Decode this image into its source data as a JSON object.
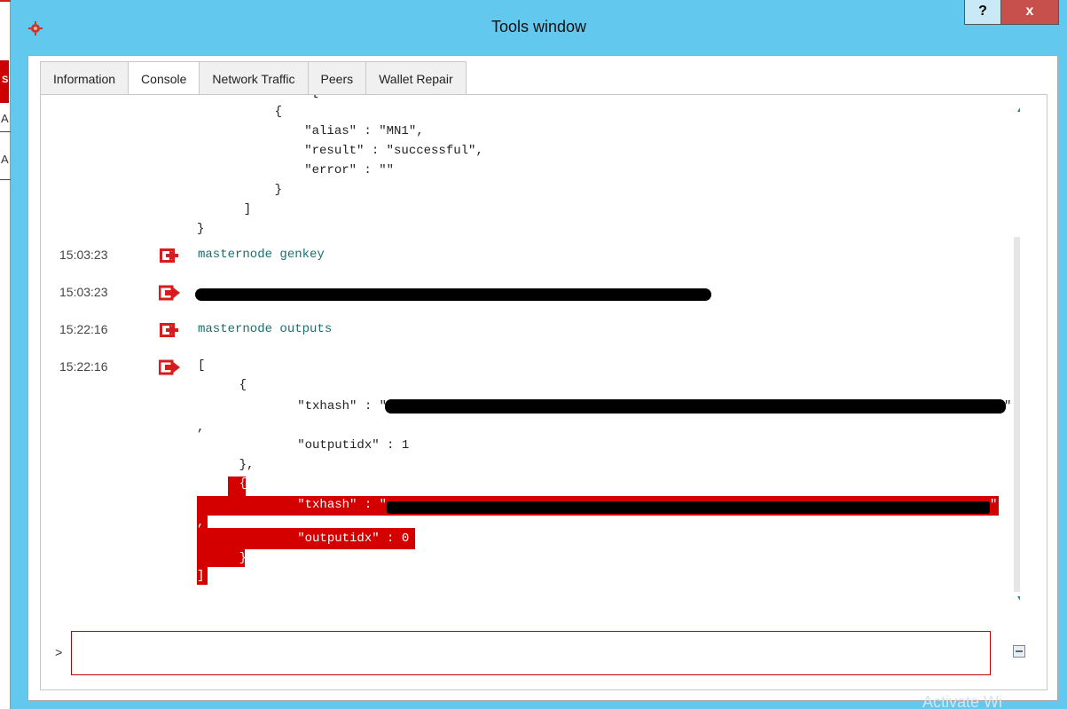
{
  "background_app": {
    "letters": [
      "S",
      "A",
      "A"
    ]
  },
  "window": {
    "title": "Tools window",
    "help_label": "?",
    "close_label": "x",
    "accent_color": "#62c8ee"
  },
  "tabs": [
    {
      "label": "Information",
      "active": false
    },
    {
      "label": "Console",
      "active": true
    },
    {
      "label": "Network Traffic",
      "active": false
    },
    {
      "label": "Peers",
      "active": false
    },
    {
      "label": "Wallet Repair",
      "active": false
    }
  ],
  "console": {
    "prev_output_lines": [
      "------ : [",
      "    {",
      "        \"alias\" : \"MN1\",",
      "        \"result\" : \"successful\",",
      "        \"error\" : \"\"",
      "    }",
      "  ]",
      "}"
    ],
    "entries": [
      {
        "time": "15:03:23",
        "kind": "command",
        "icon": "command-in-icon",
        "text": "masternode genkey"
      },
      {
        "time": "15:03:23",
        "kind": "result",
        "icon": "result-out-icon",
        "text": "[redacted]"
      },
      {
        "time": "15:22:16",
        "kind": "command",
        "icon": "command-in-icon",
        "text": "masternode outputs"
      },
      {
        "time": "15:22:16",
        "kind": "result",
        "icon": "result-out-icon",
        "text": "["
      }
    ],
    "outputs_lines": [
      "    {",
      "        \"txhash\" : \"",
      ",",
      "        \"outputidx\" : 1",
      "    },"
    ],
    "selected_lines": [
      "    {",
      "        \"txhash\" : \"",
      ",",
      "        \"outputidx\" : 0",
      "    }",
      "]"
    ],
    "txhash_closing_quote": "\"",
    "input_value": "",
    "prompt": ">",
    "selection_color": "#d40000"
  },
  "watermark": "Activate Wi"
}
